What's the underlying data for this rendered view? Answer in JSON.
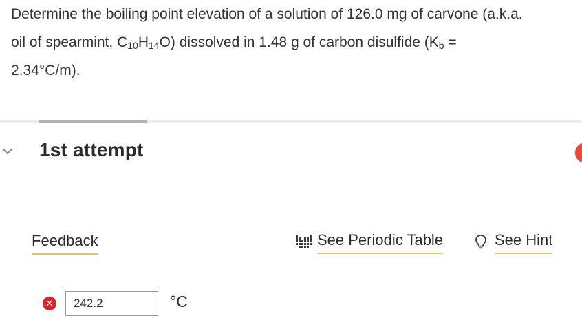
{
  "question": {
    "line1": "Determine the boiling point elevation of a solution of 126.0 mg of carvone (a.k.a.",
    "line2_a": "oil of spearmint, C",
    "sub_c": "10",
    "line2_b": "H",
    "sub_h": "14",
    "line2_c": "O) dissolved in 1.48 g of carbon disulfide (K",
    "sub_k": "b",
    "line2_d": " =",
    "line3": "2.34°C/m)."
  },
  "attempt": {
    "title": "1st attempt"
  },
  "links": {
    "feedback": "Feedback",
    "periodic_table": "See Periodic Table",
    "hint": "See Hint"
  },
  "answer": {
    "value": "242.2",
    "unit": "°C",
    "status": "incorrect"
  },
  "colors": {
    "link_underline": "#e2c565",
    "error": "#d8232a",
    "notification": "#e8493a",
    "chevron": "#8a8a8a"
  },
  "icons": {
    "chevron": "chevron-down-icon",
    "periodic_table": "periodic-table-icon",
    "hint": "lightbulb-icon",
    "error": "error-x-icon"
  }
}
